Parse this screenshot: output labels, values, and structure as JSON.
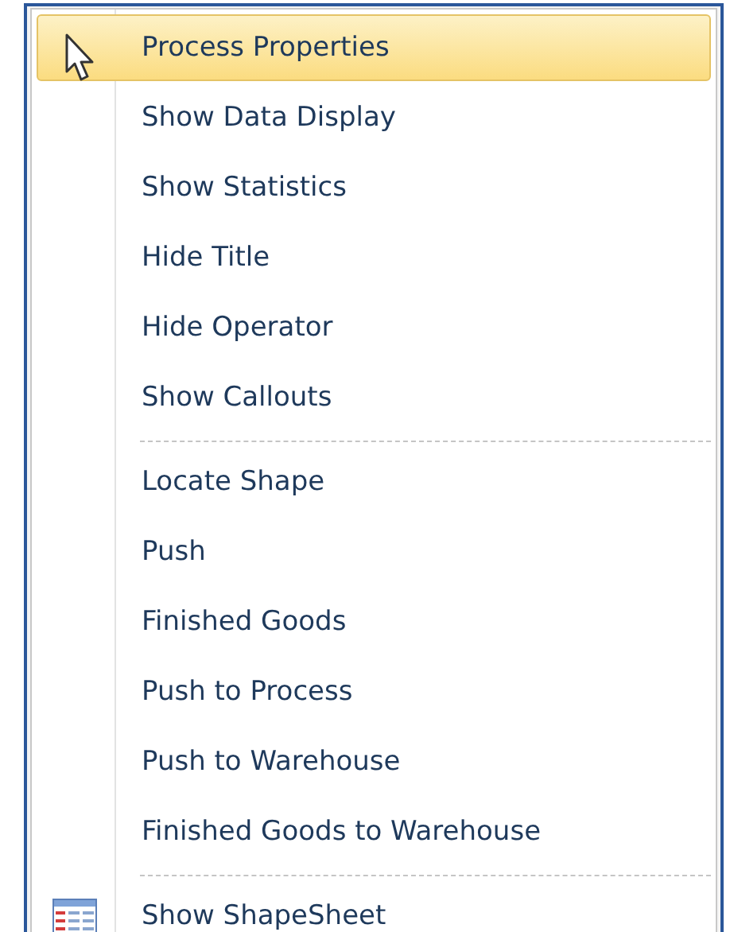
{
  "menu": {
    "groups": [
      {
        "items": [
          {
            "label": "Process Properties",
            "selected": true
          },
          {
            "label": "Show Data Display",
            "selected": false
          },
          {
            "label": "Show Statistics",
            "selected": false
          },
          {
            "label": "Hide Title",
            "selected": false
          },
          {
            "label": "Hide Operator",
            "selected": false
          },
          {
            "label": "Show Callouts",
            "selected": false
          }
        ]
      },
      {
        "items": [
          {
            "label": "Locate Shape",
            "selected": false
          },
          {
            "label": "Push",
            "selected": false
          },
          {
            "label": "Finished Goods",
            "selected": false
          },
          {
            "label": "Push to Process",
            "selected": false
          },
          {
            "label": "Push to Warehouse",
            "selected": false
          },
          {
            "label": "Finished Goods to Warehouse",
            "selected": false
          }
        ]
      },
      {
        "items": [
          {
            "label": "Show ShapeSheet",
            "selected": false,
            "kind": "table"
          }
        ]
      }
    ]
  }
}
